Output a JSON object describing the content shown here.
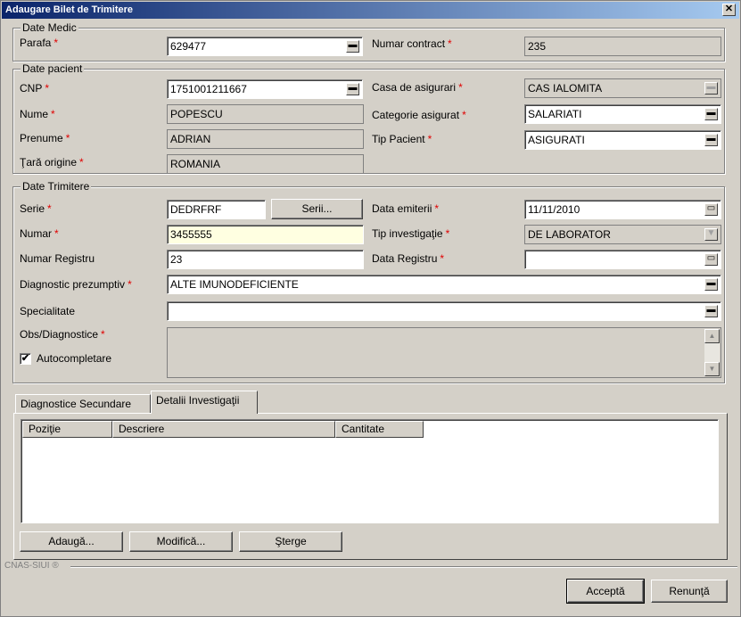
{
  "window": {
    "title": "Adaugare Bilet de Trimitere",
    "close": "✕"
  },
  "medic": {
    "group_title": "Date Medic",
    "parafa_label": "Parafa",
    "parafa_value": "629477",
    "contract_label": "Numar contract",
    "contract_value": "235"
  },
  "pacient": {
    "group_title": "Date pacient",
    "cnp_label": "CNP",
    "cnp_value": "1751001211667",
    "casa_label": "Casa de asigurari",
    "casa_value": "CAS IALOMITA",
    "nume_label": "Nume",
    "nume_value": "POPESCU",
    "categorie_label": "Categorie asigurat",
    "categorie_value": "SALARIATI",
    "prenume_label": "Prenume",
    "prenume_value": "ADRIAN",
    "tip_label": "Tip Pacient",
    "tip_value": "ASIGURATI",
    "tara_label": "Ţară origine",
    "tara_value": "ROMANIA"
  },
  "trimitere": {
    "group_title": "Date Trimitere",
    "serie_label": "Serie",
    "serie_value": "DEDRFRF",
    "serii_button": "Serii...",
    "data_emiterii_label": "Data emiterii",
    "data_emiterii_value": "11/11/2010",
    "numar_label": "Numar",
    "numar_value": "3455555",
    "tip_investigatie_label": "Tip investigaţie",
    "tip_investigatie_value": "DE LABORATOR",
    "numar_registru_label": "Numar Registru",
    "numar_registru_value": "23",
    "data_registru_label": "Data Registru",
    "data_registru_value": "",
    "diagnostic_label": "Diagnostic prezumptiv",
    "diagnostic_value": "ALTE IMUNODEFICIENTE",
    "specialitate_label": "Specialitate",
    "specialitate_value": "",
    "obs_label": "Obs/Diagnostice",
    "obs_value": "",
    "autocompletare_label": "Autocompletare",
    "autocompletare_checked": "✔"
  },
  "tabs": [
    {
      "label": "Diagnostice Secundare"
    },
    {
      "label": "Detalii Investigaţii"
    }
  ],
  "table": {
    "columns": [
      "Poziţie",
      "Descriere",
      "Cantitate"
    ],
    "rows": []
  },
  "actions": {
    "add": "Adaugă...",
    "modify": "Modifică...",
    "delete": "Şterge"
  },
  "footer": {
    "brand": "CNAS-SIUI ®",
    "accept": "Acceptă",
    "cancel": "Renunţă"
  },
  "required_marker": "*",
  "icons": {
    "dropdown": "▬",
    "calendar": "▭",
    "scroll_up": "▲",
    "scroll_down": "▼"
  }
}
